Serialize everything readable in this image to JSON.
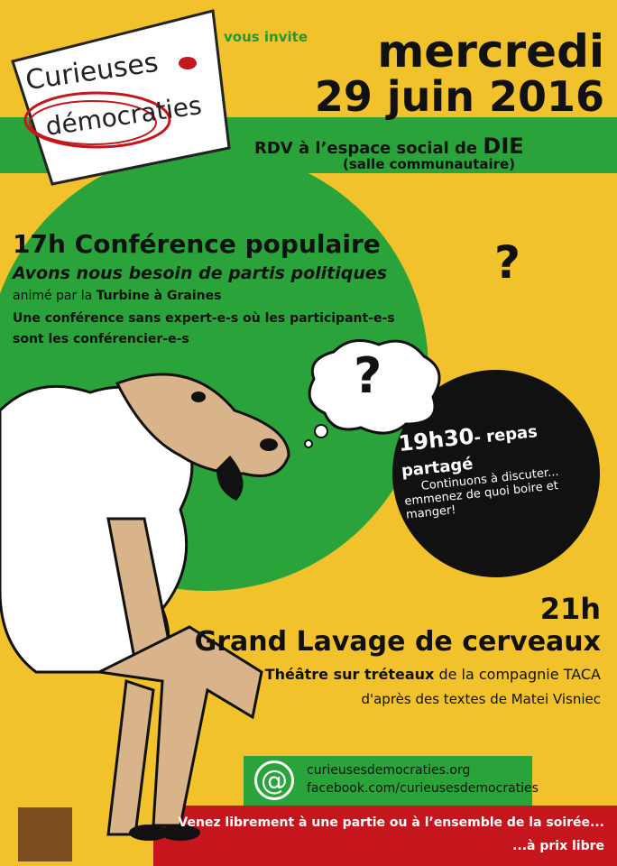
{
  "logo": {
    "line1": "Curieuses",
    "line2": "démocraties"
  },
  "invite": "vous invite",
  "date": {
    "line1": "mercredi",
    "line2": "29 juin 2016"
  },
  "venue": {
    "prefix": "RDV à l’espace social de",
    "town": "DIE",
    "room": "(salle communautaire)"
  },
  "conference": {
    "time": "17h",
    "title": "Conférence populaire",
    "question": "Avons nous besoin de partis politiques",
    "question_mark": "?",
    "animated_prefix": "animé par la",
    "animated_by": "Turbine à Graines",
    "description_line1": "Une conférence sans expert-e-s où les participant-e-s",
    "description_line2": "sont les conférencier-e-s"
  },
  "thought_bubble": "?",
  "dinner": {
    "time": "19h30",
    "title": "- repas partagé",
    "line1": "Continuons à discuter...",
    "line2": "emmenez de quoi boire et manger!"
  },
  "show": {
    "time": "21h",
    "title": "Grand Lavage de cerveaux",
    "subtitle_strong": "Théâtre sur tréteaux",
    "subtitle_rest": "de la compagnie",
    "company": "TACA",
    "author_line": "d'après des textes de Matei Visniec"
  },
  "contact": {
    "at_symbol": "@",
    "website": "curieusesdemocraties.org",
    "facebook": "facebook.com/curieusesdemocraties"
  },
  "footer": {
    "line1": "Venez librement à une partie ou à l’ensemble de la soirée...",
    "line2": "...à prix libre"
  },
  "colors": {
    "yellow": "#f2c22c",
    "green": "#2aa43a",
    "black": "#111111",
    "red": "#c4161c",
    "sheep": "#d9b48a"
  }
}
